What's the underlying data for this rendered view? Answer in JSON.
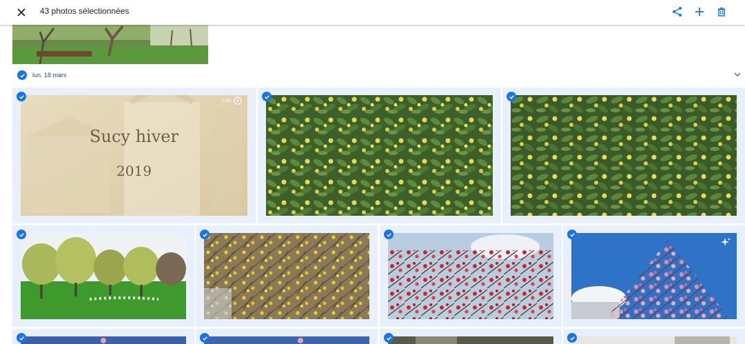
{
  "topbar": {
    "selection_count": "43 photos sélectionnées",
    "icons": [
      "close-icon",
      "share-icon",
      "add-icon",
      "delete-icon"
    ],
    "accent_color": "#1a73e8"
  },
  "date_group": {
    "label": "lun. 18 mars",
    "selected": true
  },
  "video": {
    "title_line1": "Sucy hiver",
    "title_line2": "2019",
    "duration": "1:04"
  },
  "colors": {
    "selected_bg": "#e8f0fe",
    "check_blue": "#1a73e8"
  }
}
